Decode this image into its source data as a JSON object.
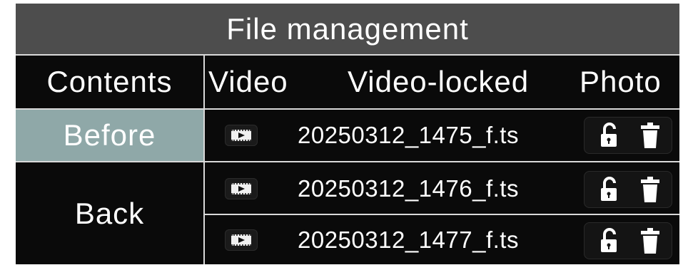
{
  "title": "File management",
  "headers": {
    "contents": "Contents",
    "video": "Video",
    "video_locked": "Video-locked",
    "photo": "Photo"
  },
  "categories": [
    {
      "label": "Before",
      "selected": true
    },
    {
      "label": "Back",
      "selected": false
    }
  ],
  "files": [
    {
      "name": "20250312_1475_f.ts",
      "type_icon": "video-file-icon",
      "actions": [
        "unlock-icon",
        "trash-icon"
      ]
    },
    {
      "name": "20250312_1476_f.ts",
      "type_icon": "video-file-icon",
      "actions": [
        "unlock-icon",
        "trash-icon"
      ]
    },
    {
      "name": "20250312_1477_f.ts",
      "type_icon": "video-file-icon",
      "actions": [
        "unlock-icon",
        "trash-icon"
      ]
    }
  ],
  "colors": {
    "header_bg": "#4d4d4d",
    "selected_bg": "#8fa8a8",
    "background": "#0a0a0a",
    "text": "#ffffff"
  }
}
